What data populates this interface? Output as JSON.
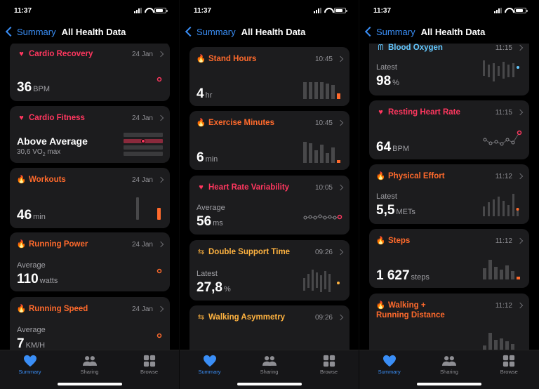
{
  "status": {
    "time": "11:37"
  },
  "nav": {
    "back_label": "Summary",
    "title": "All Health Data"
  },
  "tabs": [
    "Summary",
    "Sharing",
    "Browse"
  ],
  "colors": {
    "red": "#ff375f",
    "orange": "#ff6a2c",
    "yellow": "#ffb340",
    "blue": "#64c8ff",
    "accent": "#3a8ef6"
  },
  "screen1": {
    "cards": [
      {
        "title": "Cardio Recovery",
        "time": "24 Jan",
        "value": "36",
        "unit": "BPM",
        "icon": "heart-icon"
      },
      {
        "title": "Cardio Fitness",
        "time": "24 Jan",
        "value": "Above Average",
        "sub": "30,6 VO",
        "sub_unit": "2",
        "sub_tail": " max",
        "icon": "heart-icon"
      },
      {
        "title": "Workouts",
        "time": "24 Jan",
        "value": "46",
        "unit": "min",
        "icon": "flame-icon"
      },
      {
        "title": "Running Power",
        "time": "24 Jan",
        "label": "Average",
        "value": "110",
        "unit": "watts",
        "icon": "flame-icon"
      },
      {
        "title": "Running Speed",
        "time": "24 Jan",
        "label": "Average",
        "value": "7",
        "unit": "KM/H",
        "icon": "flame-icon"
      }
    ]
  },
  "screen2": {
    "cards": [
      {
        "title": "Stand Hours",
        "time": "10:45",
        "value": "4",
        "unit": "hr",
        "icon": "flame-icon"
      },
      {
        "title": "Exercise Minutes",
        "time": "10:45",
        "value": "6",
        "unit": "min",
        "icon": "flame-icon"
      },
      {
        "title": "Heart Rate Variability",
        "time": "10:05",
        "label": "Average",
        "value": "56",
        "unit": "ms",
        "icon": "heart-icon"
      },
      {
        "title": "Double Support Time",
        "time": "09:26",
        "label": "Latest",
        "value": "27,8",
        "unit": "%",
        "icon": "arrows-icon"
      },
      {
        "title": "Walking Asymmetry",
        "time": "09:26",
        "icon": "arrows-icon"
      }
    ]
  },
  "screen3": {
    "cards": [
      {
        "title": "Blood Oxygen",
        "time": "11:15",
        "label": "Latest",
        "value": "98",
        "unit": "%",
        "icon": "lungs-icon"
      },
      {
        "title": "Resting Heart Rate",
        "time": "11:15",
        "value": "64",
        "unit": "BPM",
        "icon": "heart-icon"
      },
      {
        "title": "Physical Effort",
        "time": "11:12",
        "label": "Latest",
        "value": "5,5",
        "unit": "METs",
        "icon": "flame-icon"
      },
      {
        "title": "Steps",
        "time": "11:12",
        "value": "1 627",
        "unit": "steps",
        "icon": "flame-icon"
      },
      {
        "title": "Walking +",
        "title2": "Running Distance",
        "time": "11:12",
        "icon": "flame-icon"
      }
    ]
  }
}
